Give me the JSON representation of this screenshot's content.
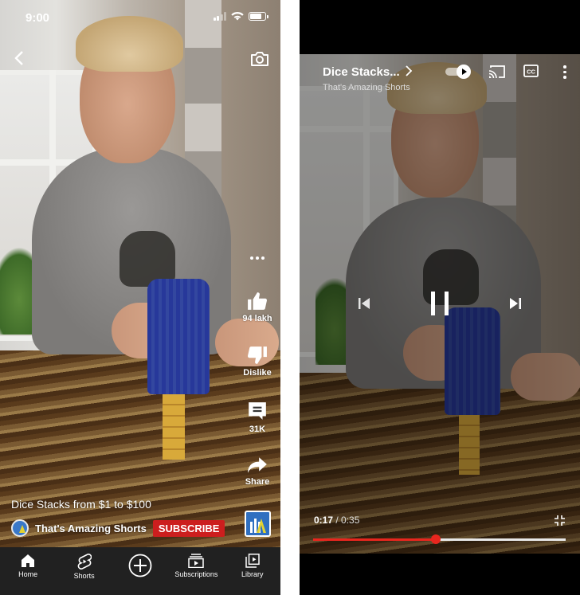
{
  "left": {
    "statusbar": {
      "time": "9:00",
      "signal_bars_on": 2,
      "signal_bars_total": 4,
      "battery_level": 0.75
    },
    "top": {
      "back_icon": "chevron-left-icon",
      "camera_icon": "camera-icon"
    },
    "actions": {
      "more_icon": "more-horizontal-icon",
      "like": {
        "icon": "thumbs-up-icon",
        "label": "94 lakh"
      },
      "dislike": {
        "icon": "thumbs-down-icon",
        "label": "Dislike"
      },
      "comments": {
        "icon": "comment-icon",
        "label": "31K"
      },
      "share": {
        "icon": "share-icon",
        "label": "Share"
      }
    },
    "video_title": "Dice Stacks from $1 to $100",
    "channel": {
      "name": "That's Amazing Shorts",
      "subscribe_label": "SUBSCRIBE",
      "subscribe_color": "#cc1e1e"
    },
    "bottom_nav": [
      {
        "label": "Home",
        "icon": "home-icon"
      },
      {
        "label": "Shorts",
        "icon": "shorts-icon"
      },
      {
        "label": "",
        "icon": "create-plus-icon"
      },
      {
        "label": "Subscriptions",
        "icon": "subscriptions-icon"
      },
      {
        "label": "Library",
        "icon": "library-icon"
      }
    ]
  },
  "right": {
    "header": {
      "title": "Dice Stacks...",
      "channel": "That's Amazing Shorts"
    },
    "controls": {
      "autoplay_on": true,
      "cast_icon": "cast-icon",
      "cc_icon": "closed-captions-icon",
      "more_icon": "more-vertical-icon",
      "prev_icon": "skip-previous-icon",
      "pause_icon": "pause-icon",
      "next_icon": "skip-next-icon",
      "exit_fullscreen_icon": "exit-fullscreen-icon"
    },
    "playback": {
      "current": "0:17",
      "separator": " / ",
      "total": "0:35",
      "progress": 0.487,
      "progress_color": "#e8261e"
    }
  }
}
